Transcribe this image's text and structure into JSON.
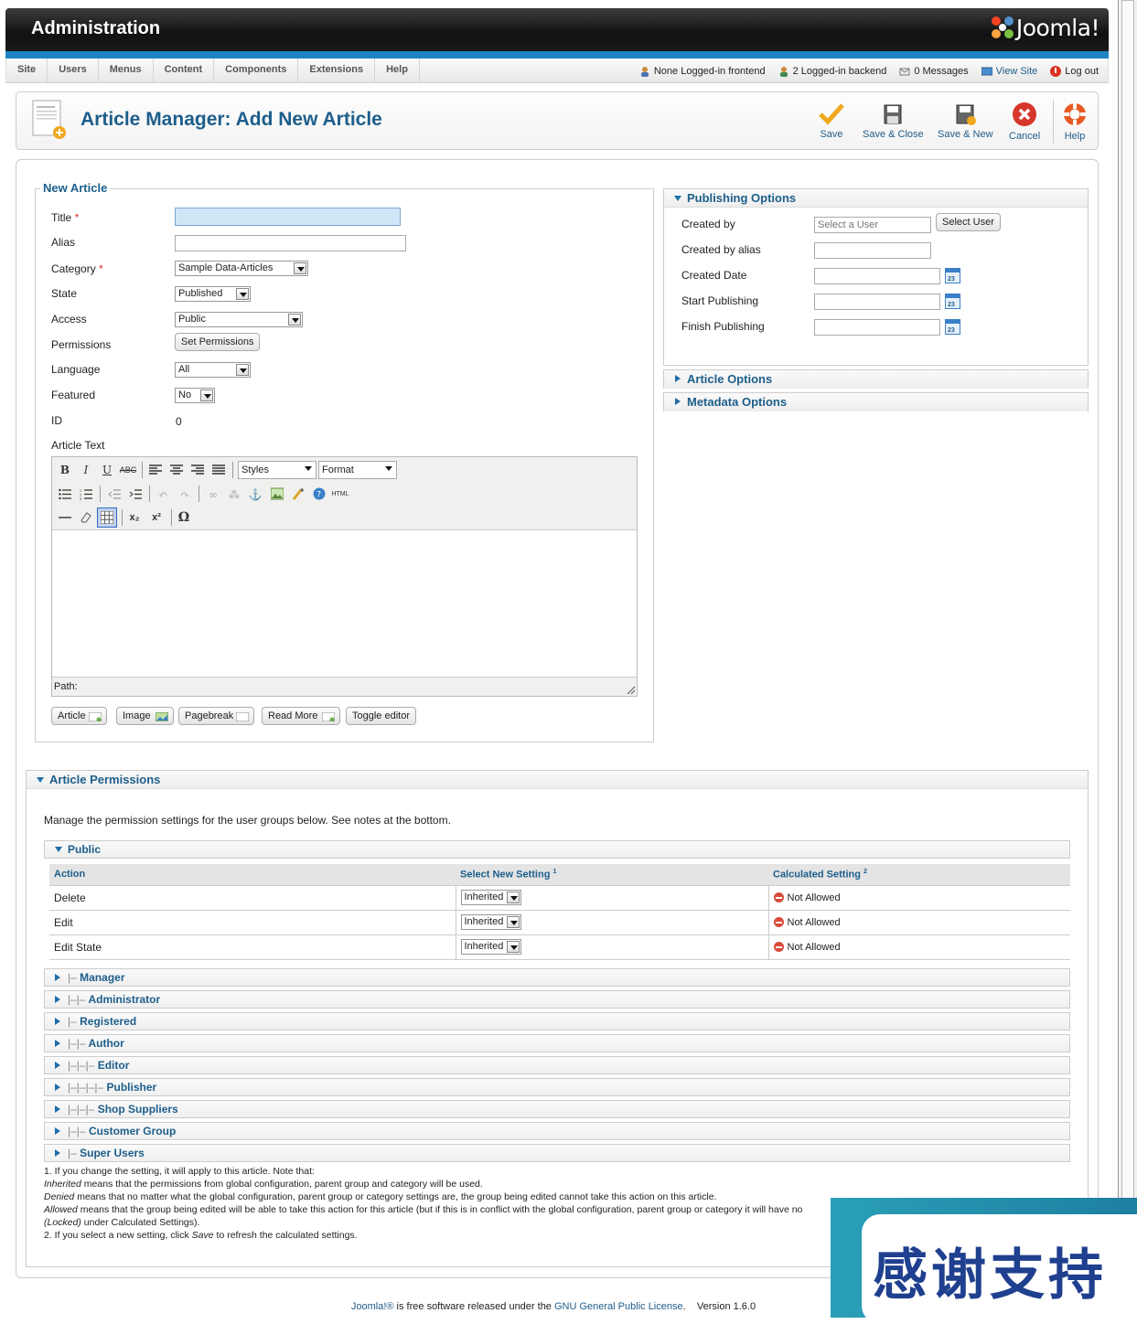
{
  "header": {
    "title": "Administration",
    "logo_text": "Joomla!"
  },
  "menu": [
    "Site",
    "Users",
    "Menus",
    "Content",
    "Components",
    "Extensions",
    "Help"
  ],
  "status": {
    "frontend": "None Logged-in frontend",
    "backend": "2 Logged-in backend",
    "messages": "0 Messages",
    "view_site": "View Site",
    "logout": "Log out"
  },
  "page_title": "Article Manager: Add New Article",
  "toolbar": {
    "save": "Save",
    "save_close": "Save & Close",
    "save_new": "Save & New",
    "cancel": "Cancel",
    "help": "Help"
  },
  "new_article": {
    "legend": "New Article",
    "title_label": "Title",
    "alias_label": "Alias",
    "category_label": "Category",
    "category_value": "Sample Data-Articles",
    "state_label": "State",
    "state_value": "Published",
    "access_label": "Access",
    "access_value": "Public",
    "permissions_label": "Permissions",
    "set_permissions": "Set Permissions",
    "language_label": "Language",
    "language_value": "All",
    "featured_label": "Featured",
    "featured_value": "No",
    "id_label": "ID",
    "id_value": "0",
    "article_text_label": "Article Text",
    "required_mark": "*"
  },
  "editor": {
    "styles": "Styles",
    "format": "Format",
    "path": "Path:",
    "buttons": {
      "article": "Article",
      "image": "Image",
      "pagebreak": "Pagebreak",
      "readmore": "Read More",
      "toggle": "Toggle editor"
    }
  },
  "publishing": {
    "title": "Publishing Options",
    "created_by": "Created by",
    "created_by_placeholder": "Select a User",
    "select_user": "Select User",
    "created_by_alias": "Created by alias",
    "created_date": "Created Date",
    "start_publishing": "Start Publishing",
    "finish_publishing": "Finish Publishing"
  },
  "article_options": "Article Options",
  "metadata_options": "Metadata Options",
  "permissions": {
    "title": "Article Permissions",
    "intro": "Manage the permission settings for the user groups below. See notes at the bottom.",
    "public_group": "Public",
    "col_action": "Action",
    "col_select": "Select New Setting",
    "col_select_sup": "1",
    "col_calc": "Calculated Setting",
    "col_calc_sup": "2",
    "rows": [
      {
        "action": "Delete",
        "setting": "Inherited",
        "calc": "Not Allowed"
      },
      {
        "action": "Edit",
        "setting": "Inherited",
        "calc": "Not Allowed"
      },
      {
        "action": "Edit State",
        "setting": "Inherited",
        "calc": "Not Allowed"
      }
    ],
    "groups": [
      {
        "prefix": "|–",
        "name": "Manager"
      },
      {
        "prefix": "|–|–",
        "name": "Administrator"
      },
      {
        "prefix": "|–",
        "name": "Registered"
      },
      {
        "prefix": "|–|–",
        "name": "Author"
      },
      {
        "prefix": "|–|–|–",
        "name": "Editor"
      },
      {
        "prefix": "|–|–|–|–",
        "name": "Publisher"
      },
      {
        "prefix": "|–|–|–",
        "name": "Shop Suppliers"
      },
      {
        "prefix": "|–|–",
        "name": "Customer Group"
      },
      {
        "prefix": "|–",
        "name": "Super Users"
      }
    ],
    "notes": {
      "n1": "1. If you change the setting, it will apply to this article. Note that:",
      "inherited_term": "Inherited",
      "inherited_text": " means that the permissions from global configuration, parent group and category will be used.",
      "denied_term": "Denied",
      "denied_text": " means that no matter what the global configuration, parent group or category settings are, the group being edited cannot take this action on this article.",
      "allowed_term": "Allowed",
      "allowed_text": " means that the group being edited will be able to take this action for this article (but if this is in conflict with the global configuration, parent group or category it will have no",
      "locked_term": "(Locked)",
      "locked_text": " under Calculated Settings).",
      "n2a": "2. If you select a new setting, click ",
      "n2_save": "Save",
      "n2b": " to refresh the calculated settings."
    }
  },
  "footer": {
    "joomla": "Joomla!®",
    "text1": " is free software released under the ",
    "license": "GNU General Public License",
    "text2": ".    Version 1.6.0"
  },
  "banner": {
    "text": "感谢支持"
  },
  "colors": {
    "accent": "#1d86c2",
    "title_blue": "#1d5e8b",
    "save_orange": "#f0a81e",
    "cancel_red": "#d6372a"
  }
}
